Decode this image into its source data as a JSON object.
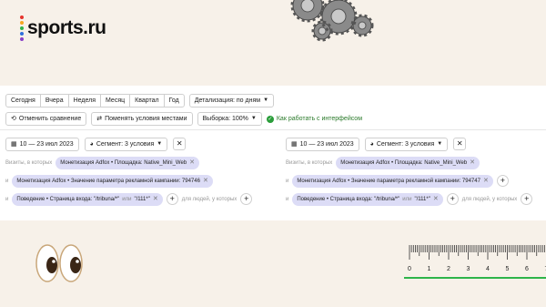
{
  "brand": {
    "name": "sports.ru",
    "dot_colors": [
      "#e6342c",
      "#f5a623",
      "#2eb44a",
      "#2f6fdc",
      "#8a3fc8"
    ]
  },
  "toolbar": {
    "periods": [
      "Сегодня",
      "Вчера",
      "Неделя",
      "Месяц",
      "Квартал",
      "Год"
    ],
    "detail_label": "Детализация: по дням"
  },
  "actions": {
    "cancel_compare": "Отменить сравнение",
    "swap_conditions": "Поменять условия местами",
    "sample": "Выборка: 100%",
    "help": "Как работать с интерфейсом"
  },
  "compare": {
    "left": {
      "date_range": "10 — 23 июл 2023",
      "segment": "Сегмент: 3 условия",
      "visits_label": "Визиты, в которых",
      "and_label": "и",
      "cond1": "Монетизация Adfox • Площадка: Native_Mini_Web",
      "cond2": "Монетизация Adfox • Значение параметра рекламной кампании: 794746",
      "cond3_prefix": "Поведение • Страница входа: \"/tribuna/*\"",
      "cond3_or": "или",
      "cond3_suffix": "\"/111*\"",
      "people_hint": "для людей, у которых"
    },
    "right": {
      "date_range": "10 — 23 июл 2023",
      "segment": "Сегмент: 3 условия",
      "visits_label": "Визиты, в которых",
      "and_label": "и",
      "cond1": "Монетизация Adfox • Площадка: Native_Mini_Web",
      "cond2": "Монетизация Adfox • Значение параметра рекламной кампании: 794747",
      "cond3_prefix": "Поведение • Страница входа: \"/tribuna/*\"",
      "cond3_or": "или",
      "cond3_suffix": "\"/111*\"",
      "people_hint": "для людей, у которых"
    }
  },
  "ruler": {
    "numbers": [
      "0",
      "1",
      "2",
      "3",
      "4",
      "5",
      "6",
      "7"
    ]
  },
  "icons": [
    "gears-icon",
    "calendar-icon",
    "segment-icon",
    "close-icon",
    "plus-icon",
    "eyes-icon",
    "ruler-icon",
    "help-icon"
  ],
  "colors": {
    "background": "#f7f1e9",
    "chip": "#dcdcf6",
    "accent_green": "#2a9d3a"
  }
}
